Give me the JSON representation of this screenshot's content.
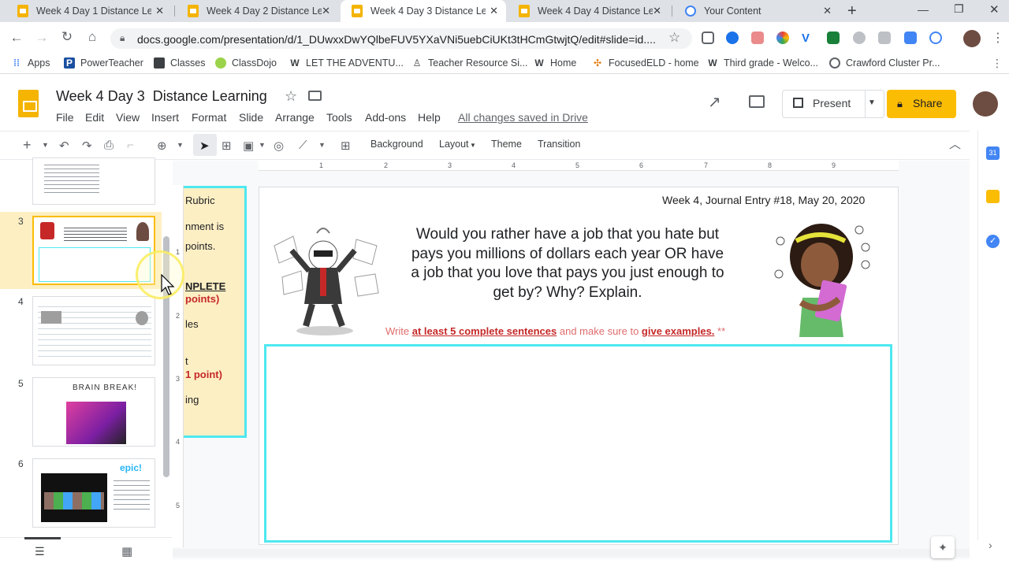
{
  "browser": {
    "tabs": [
      {
        "title": "Week 4 Day 1 Distance Lea",
        "active": false
      },
      {
        "title": "Week 4 Day 2 Distance Lea",
        "active": false
      },
      {
        "title": "Week 4 Day 3 Distance Lea",
        "active": true
      },
      {
        "title": "Week 4 Day 4 Distance Lea",
        "active": false
      },
      {
        "title": "Your Content",
        "active": false
      }
    ],
    "new_tab": "+",
    "url": "docs.google.com/presentation/d/1_DUwxxDwYQlbeFUV5YXaVNi5uebCiUKt3tHCmGtwjtQ/edit#slide=id....",
    "bookmarks": [
      "Apps",
      "PowerTeacher",
      "Classes",
      "ClassDojo",
      "LET THE ADVENTU...",
      "Teacher Resource Si...",
      "Home",
      "FocusedELD - home",
      "Third grade - Welco...",
      "Crawford Cluster Pr..."
    ]
  },
  "app": {
    "title": "Week 4 Day 3  Distance Learning",
    "menus": [
      "File",
      "Edit",
      "View",
      "Insert",
      "Format",
      "Slide",
      "Arrange",
      "Tools",
      "Add-ons",
      "Help"
    ],
    "save_status": "All changes saved in Drive",
    "present_label": "Present",
    "share_label": "Share"
  },
  "toolbar": {
    "background": "Background",
    "layout": "Layout",
    "theme": "Theme",
    "transition": "Transition"
  },
  "filmstrip": {
    "numbers": [
      "3",
      "4",
      "5",
      "6"
    ],
    "thumb5_title": "BRAIN BREAK!",
    "thumb6_badge": "epic!"
  },
  "ruler": {
    "top": [
      "1",
      "2",
      "3",
      "4",
      "5",
      "6",
      "7",
      "8",
      "9"
    ],
    "left": [
      "1",
      "2",
      "3",
      "4",
      "5"
    ]
  },
  "rubric": {
    "lines": [
      "Rubric",
      "nment is",
      "points.",
      "NPLETE",
      "points)",
      "les",
      "t",
      "1 point)",
      "ing"
    ]
  },
  "slide": {
    "heading": "Week 4, Journal Entry #18, May 20, 2020",
    "question": "Would you rather have a job that you hate but pays you millions of dollars each year OR have a job that you love that pays you just enough to get by? Why? Explain.",
    "instr_pre": "Write ",
    "instr_b1": "at least 5 complete sentences",
    "instr_mid": " and make sure to ",
    "instr_b2": "give examples.",
    "instr_post": " **"
  },
  "colors": {
    "accent": "#fbbc04",
    "slide_border": "#4ee8f0",
    "selected_thumb": "#feefc3",
    "red_text": "#c62828"
  }
}
